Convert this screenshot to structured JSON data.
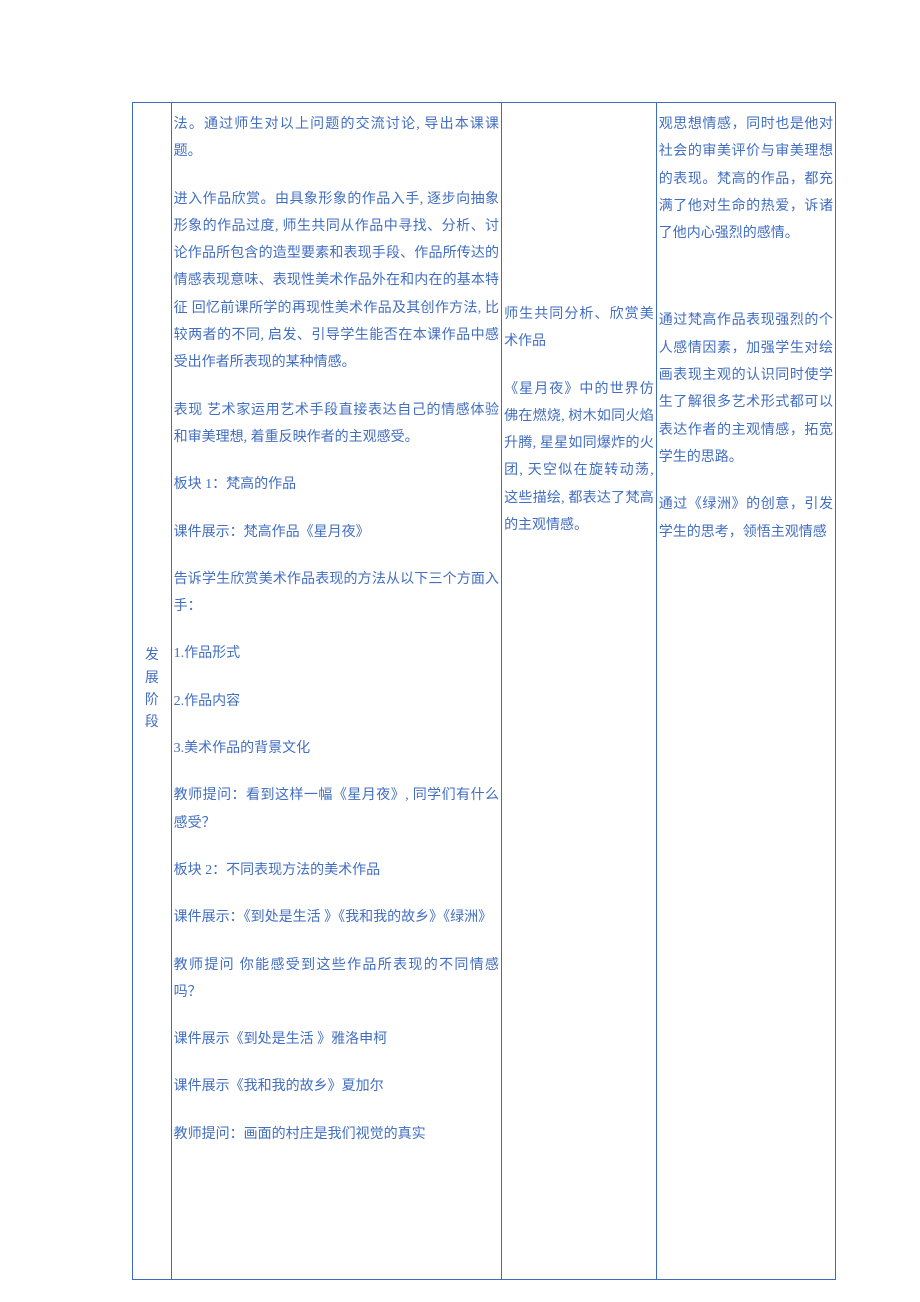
{
  "col1": {
    "label": "发展阶段"
  },
  "col2": {
    "p1": "法。通过师生对以上问题的交流讨论, 导出本课课题。",
    "p2": "进入作品欣赏。由具象形象的作品入手, 逐步向抽象形象的作品过度, 师生共同从作品中寻找、分析、讨论作品所包含的造型要素和表现手段、作品所传达的情感表现意味、表现性美术作品外在和内在的基本特征  回忆前课所学的再现性美术作品及其创作方法, 比较两者的不同, 启发、引导学生能否在本课作品中感受出作者所表现的某种情感。",
    "p3": "表现 艺术家运用艺术手段直接表达自己的情感体验和审美理想, 着重反映作者的主观感受。",
    "p4": "板块 1：梵高的作品",
    "p5": "课件展示：梵高作品《星月夜》",
    "p6": "告诉学生欣赏美术作品表现的方法从以下三个方面入手：",
    "p7": "1.作品形式",
    "p8": "2.作品内容",
    "p9": "3.美术作品的背景文化",
    "p10": "教师提问：看到这样一幅《星月夜》, 同学们有什么感受？",
    "p11": "板块 2：不同表现方法的美术作品",
    "p12": "课件展示：《到处是生活 》《我和我的故乡》《绿洲》",
    "p13": "教师提问 你能感受到这些作品所表现的不同情感吗？",
    "p14": "课件展示《到处是生活 》雅洛申柯",
    "p15": "课件展示《我和我的故乡》夏加尔",
    "p16": "教师提问：画面的村庄是我们视觉的真实"
  },
  "col3": {
    "p1": "师生共同分析、欣赏美术作品",
    "p2": "《星月夜》中的世界仿佛在燃烧, 树木如同火焰升腾, 星星如同爆炸的火团, 天空似在旋转动荡, 这些描绘, 都表达了梵高的主观情感。"
  },
  "col4": {
    "p1": "观思想情感，同时也是他对社会的审美评价与审美理想的表现。梵高的作品，都充满了他对生命的热爱，诉诸了他内心强烈的感情。",
    "p2": "通过梵高作品表现强烈的个人感情因素，加强学生对绘画表现主观的认识同时使学生了解很多艺术形式都可以表达作者的主观情感，拓宽学生的思路。",
    "p3": "通过《绿洲》的创意，引发学生的思考，领悟主观情感"
  }
}
